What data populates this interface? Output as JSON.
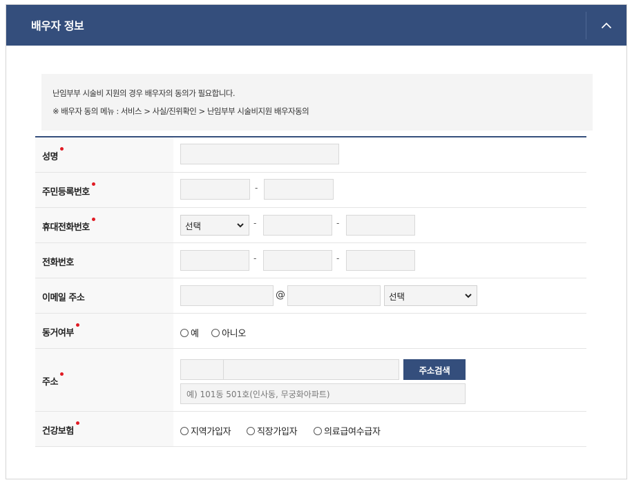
{
  "panel": {
    "title": "배우자 정보",
    "collapse_icon": "chevron-up-icon"
  },
  "notice": {
    "line1": "난임부부 시술비 지원의 경우 배우자의 동의가 필요합니다.",
    "line2": "※ 배우자 동의 메뉴 : 서비스 > 사실/진위확인 > 난임부부 시술비지원 배우자동의"
  },
  "form": {
    "name": {
      "label": "성명",
      "required": true,
      "value": ""
    },
    "rrn": {
      "label": "주민등록번호",
      "required": true,
      "dash": "-"
    },
    "mobile": {
      "label": "휴대전화번호",
      "required": true,
      "select_value": "선택",
      "dash": "-"
    },
    "phone": {
      "label": "전화번호",
      "required": false,
      "dash": "-"
    },
    "email": {
      "label": "이메일 주소",
      "required": false,
      "at": "@",
      "select_value": "선택"
    },
    "cohabit": {
      "label": "동거여부",
      "required": true,
      "options": [
        "예",
        "아니오"
      ]
    },
    "address": {
      "label": "주소",
      "required": true,
      "search_label": "주소검색",
      "placeholder": "예) 101동 501호(인사동, 무궁화아파트)"
    },
    "insurance": {
      "label": "건강보험",
      "required": true,
      "options": [
        "지역가입자",
        "직장가입자",
        "의료급여수급자"
      ]
    }
  }
}
